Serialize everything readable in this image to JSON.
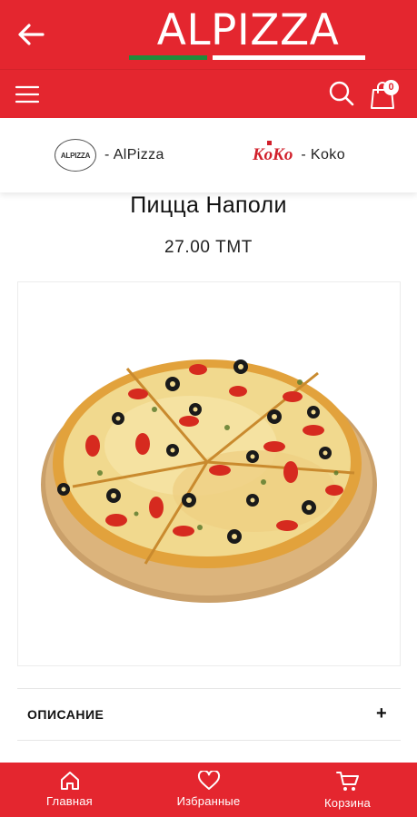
{
  "header": {
    "logo_text": "ALPIZZA",
    "cart_count": "0",
    "brand_color": "#e4262f",
    "icons": [
      "back-arrow-icon",
      "menu-icon",
      "search-icon",
      "shopping-bag-icon"
    ]
  },
  "brands": [
    {
      "label": "- AlPizza",
      "logo_text": "ALPIZZA"
    },
    {
      "label": "- Koko",
      "logo_text": "KoKo"
    }
  ],
  "product": {
    "title": "Пицца Наполи",
    "price": "27.00 TMT",
    "image": "pizza-photo"
  },
  "details": {
    "description_label": "ОПИСАНИЕ",
    "expand_symbol": "+"
  },
  "bottom_nav": [
    {
      "label": "Главная",
      "icon": "home-icon"
    },
    {
      "label": "Избранные",
      "icon": "heart-icon"
    },
    {
      "label": "Корзина",
      "icon": "cart-icon"
    }
  ]
}
